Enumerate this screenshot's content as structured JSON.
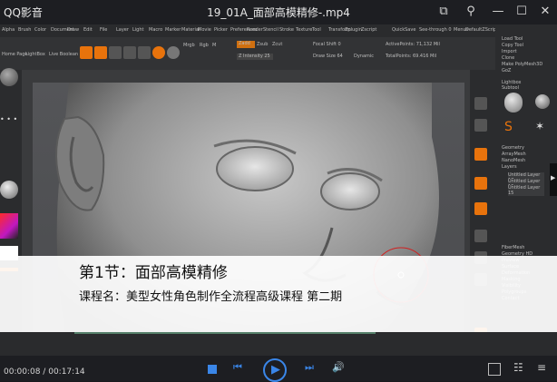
{
  "player": {
    "app_name": "QQ影音",
    "file_title": "19_01A_面部高模精修-.mp4",
    "time_current": "00:00:08",
    "time_separator": "/",
    "time_total": "00:17:14"
  },
  "zbrush": {
    "menu": [
      "Alpha",
      "Brush",
      "Color",
      "Document",
      "Draw",
      "Edit",
      "File",
      "Layer",
      "Light",
      "Macro",
      "Marker",
      "Material",
      "Movie",
      "Picker",
      "Preferences",
      "Render",
      "Stencil",
      "Stroke",
      "Texture",
      "Tool",
      "Transform",
      "Zplugin",
      "Zscript"
    ],
    "quicksave": "QuickSave",
    "see_through": "See-through 0",
    "menus": "Menus",
    "default_zscript": "DefaultZScript",
    "toolbar": {
      "left_labels": [
        "Home Page",
        "LightBox",
        "Live Boolean"
      ],
      "mrgb": "Mrgb",
      "rgb": "Rgb",
      "m": "M",
      "zadd": "Zadd",
      "zsub": "Zsub",
      "zcut": "Zcut",
      "z_intensity": "Z Intensity 25",
      "focal_shift": "Focal Shift 0",
      "draw_size": "Draw Size 64",
      "dynamic": "Dynamic",
      "active_points": "ActivePoints: 71,132 Mil",
      "total_points": "TotalPoints: 69.416 Mil"
    },
    "tray": {
      "items": [
        "Load Tool",
        "Copy Tool",
        "Import",
        "Clone",
        "Make PolyMesh3D",
        "GoZ",
        "Lightbox",
        "Subtool",
        "Geometry",
        "ArrayMesh",
        "NanoMesh",
        "Layers",
        "FiberMesh",
        "Geometry HD",
        "Preview",
        "Surface",
        "Deformation",
        "Masking",
        "Visibility",
        "Polygroups",
        "Contact"
      ],
      "layers": [
        "Untitled Layer 17",
        "Untitled Layer 16",
        "Untitled Layer 15"
      ]
    }
  },
  "subtitle": {
    "title": "第1节：面部高模精修",
    "course": "课程名：美型女性角色制作全流程高级课程 第二期"
  },
  "icons": {
    "pin": "pin-icon",
    "fullscreen": "fullscreen-icon",
    "minimize": "minimize-icon",
    "maximize": "maximize-icon",
    "close": "close-icon",
    "stop": "stop-icon",
    "prev": "prev-icon",
    "play": "play-icon",
    "next": "next-icon",
    "volume": "volume-icon",
    "screenshot": "screenshot-icon",
    "settings": "settings-icon",
    "playlist": "playlist-icon"
  },
  "colors": {
    "accent": "#3a86e8",
    "zbrush_orange": "#e8730c"
  }
}
